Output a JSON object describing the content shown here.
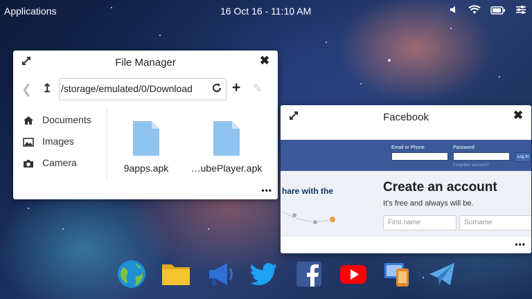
{
  "topbar": {
    "applications_label": "Applications",
    "clock": "16 Oct 16 - 11:10 AM"
  },
  "file_manager": {
    "title": "File Manager",
    "path": "/storage/emulated/0/Download",
    "sidebar": [
      {
        "label": "Documents",
        "icon": "home-icon"
      },
      {
        "label": "Images",
        "icon": "image-icon"
      },
      {
        "label": "Camera",
        "icon": "camera-icon"
      }
    ],
    "files": [
      {
        "name": "9apps.apk",
        "icon": "file-icon"
      },
      {
        "name": "…ubePlayer.apk",
        "icon": "file-icon"
      }
    ],
    "more": "•••"
  },
  "facebook": {
    "title": "Facebook",
    "email_label": "Email or Phone",
    "password_label": "Password",
    "login_label": "Log In",
    "forgot_label": "Forgotten account?",
    "share_text": "hare with the",
    "create_heading": "Create an account",
    "free_text": "It's free and always will be.",
    "first_name_placeholder": "First name",
    "surname_placeholder": "Surname",
    "more": "•••"
  },
  "dock": [
    {
      "icon": "browser-globe-icon"
    },
    {
      "icon": "folder-icon"
    },
    {
      "icon": "megaphone-icon"
    },
    {
      "icon": "twitter-icon"
    },
    {
      "icon": "facebook-icon"
    },
    {
      "icon": "youtube-icon"
    },
    {
      "icon": "devices-icon"
    },
    {
      "icon": "telegram-icon"
    }
  ],
  "colors": {
    "facebook_blue": "#3b5998",
    "twitter_blue": "#1da1f2",
    "youtube_red": "#ff0000",
    "folder_yellow": "#f4c430",
    "file_blue": "#90c2f0"
  }
}
